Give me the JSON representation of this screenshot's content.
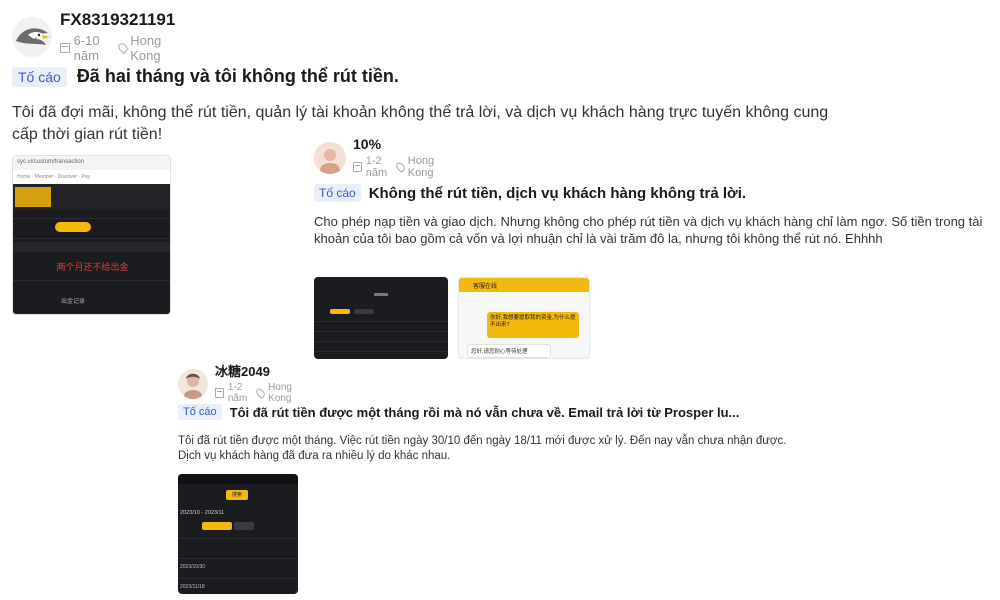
{
  "posts": [
    {
      "username": "FX8319321191",
      "experience": "6-10 năm",
      "location": "Hong Kong",
      "badge": "Tố cáo",
      "title": "Đã hai tháng và tôi không thể rút tiền.",
      "body": "Tôi đã đợi mãi, không thể rút tiền, quản lý tài khoản không thể trả lời, và dịch vụ khách hàng trực tuyến không cung cấp thời gian rút tiền!",
      "thumb": {
        "url_text": "syc.vi/custom/transaction",
        "tabs": [
          "Home",
          "Member",
          "Discover",
          "Pay"
        ],
        "red_text": "两个月还不给出金",
        "footer_label": "出金记录"
      }
    },
    {
      "username": "10%",
      "experience": "1-2 năm",
      "location": "Hong Kong",
      "badge": "Tố cáo",
      "title": "Không thể rút tiền, dịch vụ khách hàng không trả lời.",
      "body": "Cho phép nạp tiền và giao dịch. Nhưng không cho phép rút tiền và dịch vụ khách hàng chỉ làm ngơ. Số tiền trong tài khoản của tôi bao gồm cả vốn và lợi nhuận chỉ là vài trăm đô la, nhưng tôi không thể rút nó. Ehhhh",
      "thumb2": {
        "header": "客服在线",
        "msg_user": "你好,我想要提取我的资金,为什么提不出来?",
        "msg_agent": "您好,请您耐心等待处理"
      }
    },
    {
      "username": "冰糖2049",
      "experience": "1-2 năm",
      "location": "Hong Kong",
      "badge": "Tố cáo",
      "title": "Tôi đã rút tiền được một tháng rồi mà nó vẫn chưa về. Email trả lời từ Prosper lu...",
      "body": "Tôi đã rút tiền được một tháng. Việc rút tiền ngày 30/10 đến ngày 18/11 mới được xử lý. Đến nay vẫn chưa nhận được. Dịch vụ khách hàng đã đưa ra nhiều lý do khác nhau.",
      "thumb": {
        "date_range": "2023/10 - 2023/11",
        "button": "搜索",
        "rows": [
          "2023/10/30",
          "2023/11/18"
        ]
      }
    }
  ]
}
